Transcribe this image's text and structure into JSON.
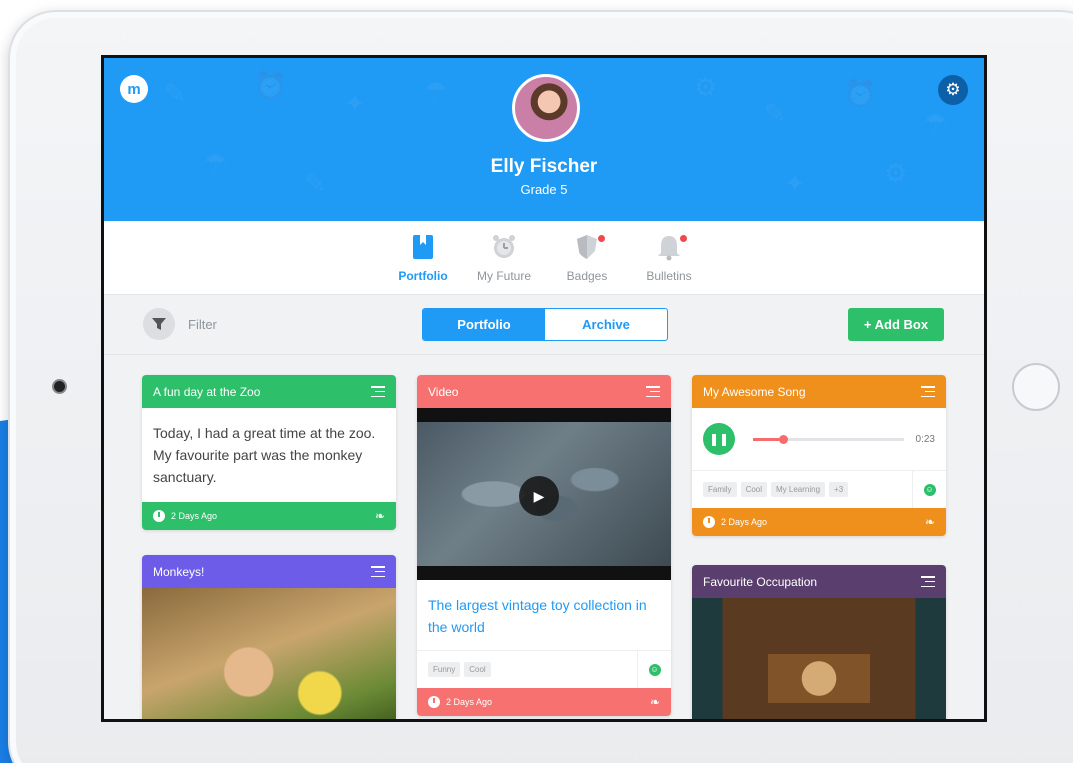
{
  "app": {
    "logo_glyph": "m",
    "settings_icon": "gear-icon"
  },
  "profile": {
    "name": "Elly Fischer",
    "grade": "Grade 5"
  },
  "nav": {
    "items": [
      {
        "label": "Portfolio",
        "icon": "portfolio-icon",
        "active": true
      },
      {
        "label": "My Future",
        "icon": "alarm-clock-icon",
        "active": false
      },
      {
        "label": "Badges",
        "icon": "shield-icon",
        "active": false
      },
      {
        "label": "Bulletins",
        "icon": "bell-icon",
        "active": false
      }
    ]
  },
  "toolbar": {
    "filter_label": "Filter",
    "segments": [
      "Portfolio",
      "Archive"
    ],
    "selected_segment": "Portfolio",
    "add_label": "+ Add Box"
  },
  "cards": {
    "zoo": {
      "title": "A fun day at the Zoo",
      "text": "Today, I had a great time at the zoo. My favourite part was the monkey sanctuary.",
      "time": "2 Days Ago",
      "color": "#2dbf69"
    },
    "monkeys": {
      "title": "Monkeys!",
      "color": "#6c5ce7"
    },
    "video": {
      "title": "Video",
      "caption": "The largest vintage toy collection in the world",
      "tags": [
        "Funny",
        "Cool"
      ],
      "time": "2 Days Ago",
      "color": "#f87171"
    },
    "song": {
      "title": "My Awesome Song",
      "duration": "0:23",
      "progress": 0.2,
      "tags": [
        "Family",
        "Cool",
        "My Learning",
        "+3"
      ],
      "time": "2 Days Ago",
      "color": "#f0901c"
    },
    "occupation": {
      "title": "Favourite Occupation",
      "color": "#5a3f6e"
    }
  },
  "colors": {
    "primary": "#1f9af5",
    "green": "#2dbf69",
    "alert": "#f0484b"
  }
}
